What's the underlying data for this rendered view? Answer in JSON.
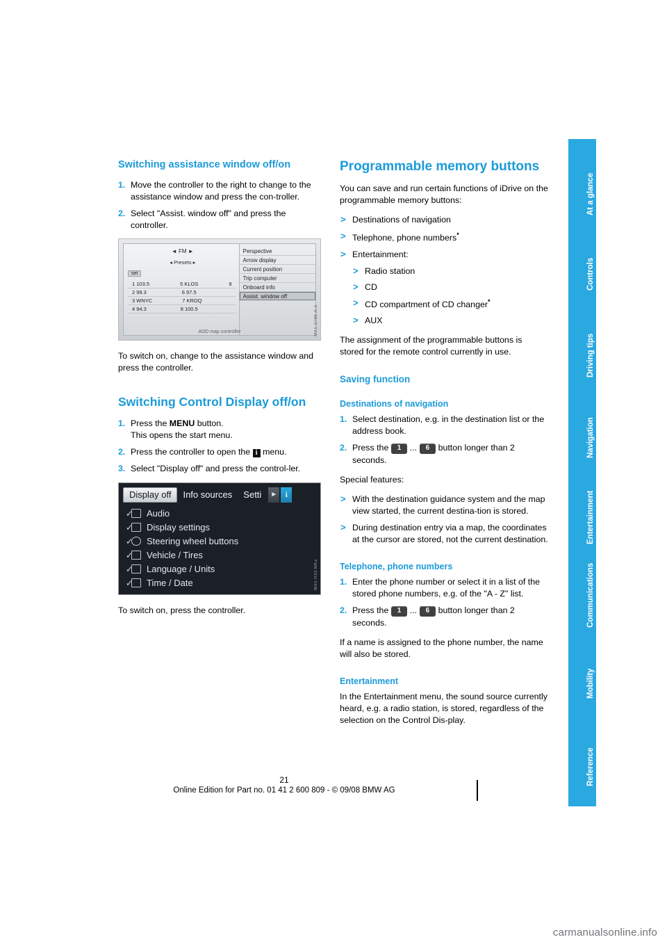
{
  "document": {
    "page_number": "21",
    "footer_line": "Online Edition for Part no. 01 41 2 600 809 - © 09/08 BMW AG",
    "watermark": "carmanualsonline.info"
  },
  "tabs": [
    {
      "label": "At a glance"
    },
    {
      "label": "Controls"
    },
    {
      "label": "Driving tips"
    },
    {
      "label": "Navigation"
    },
    {
      "label": "Entertainment"
    },
    {
      "label": "Communications"
    },
    {
      "label": "Mobility"
    },
    {
      "label": "Reference"
    }
  ],
  "left_column": {
    "heading_1": "Switching assistance window off/on",
    "steps_1": [
      {
        "num": "1.",
        "text": "Move the controller to the right to change to the assistance window and press the con-troller."
      },
      {
        "num": "2.",
        "text": "Select \"Assist. window off\" and press the controller."
      }
    ],
    "figure_1": {
      "code": "MX1-3788-A-A",
      "tabs": "◄   FM   ►",
      "presets": "◂ Presets ▸",
      "set_label": "set",
      "rows": [
        {
          "left": "1 103.5",
          "right": "5 KLOS",
          "num": "9"
        },
        {
          "left": "2 99.3",
          "right": "6 97.5",
          "num": ""
        },
        {
          "left": "3 WNYC",
          "right": "7 KROQ",
          "num": ""
        },
        {
          "left": "4 94.3",
          "right": "8 100.5",
          "num": ""
        }
      ],
      "menu": [
        "Perspective",
        "Arrow display",
        "Current position",
        "Trip computer",
        "Onboard info",
        "Assist. window off"
      ],
      "selected_menu_item": "Assist. window off",
      "bottom_text": "ADD map  controller"
    },
    "paragraph_1": "To switch on, change to the assistance window and press the controller.",
    "heading_2": "Switching Control Display off/on",
    "steps_2": [
      {
        "num": "1.",
        "text_pre": "Press the ",
        "bold": "MENU",
        "text_post": " button.",
        "text_line2": "This opens the start menu."
      },
      {
        "num": "2.",
        "text_pre": "Press the controller to open the ",
        "icon": "i",
        "text_post": " menu."
      },
      {
        "num": "3.",
        "text": "Select \"Display off\" and press the control-ler."
      }
    ],
    "figure_2": {
      "code": "MX0 R33 MKZ",
      "tab_active": "Display off",
      "tab_2": "Info sources",
      "tab_3": "Setti",
      "arrow_icon": "►",
      "info_icon": "i",
      "items": [
        "Audio",
        "Display settings",
        "Steering wheel buttons",
        "Vehicle / Tires",
        "Language / Units",
        "Time / Date"
      ]
    },
    "paragraph_2": "To switch on, press the controller."
  },
  "right_column": {
    "heading_1": "Programmable memory buttons",
    "paragraph_1": "You can save and run certain functions of iDrive on the programmable memory buttons:",
    "bullets_1": [
      {
        "text": "Destinations of navigation",
        "level": 1,
        "sup": ""
      },
      {
        "text": "Telephone, phone numbers",
        "level": 1,
        "sup": "*"
      },
      {
        "text": "Entertainment:",
        "level": 1,
        "sup": ""
      },
      {
        "text": "Radio station",
        "level": 2,
        "sup": ""
      },
      {
        "text": "CD",
        "level": 2,
        "sup": ""
      },
      {
        "text": "CD compartment of CD changer",
        "level": 2,
        "sup": "*"
      },
      {
        "text": "AUX",
        "level": 2,
        "sup": ""
      }
    ],
    "paragraph_2": "The assignment of the programmable buttons is stored for the remote control currently in use.",
    "heading_2": "Saving function",
    "heading_3": "Destinations of navigation",
    "steps_1": [
      {
        "num": "1.",
        "text": "Select destination, e.g. in the destination list or the address book."
      },
      {
        "num": "2.",
        "text_pre": "Press the ",
        "key1": "1",
        "mid": " ... ",
        "key2": "6",
        "text_post": " button longer than 2 seconds."
      }
    ],
    "paragraph_3": "Special features:",
    "bullets_2": [
      {
        "text": "With the destination guidance system and the map view started, the current destina-tion is stored."
      },
      {
        "text": "During destination entry via a map, the coordinates at the cursor are stored, not the current destination."
      }
    ],
    "heading_4": "Telephone, phone numbers",
    "steps_2": [
      {
        "num": "1.",
        "text": "Enter the phone number or select it in a list of the stored phone numbers, e.g. of the \"A - Z\" list."
      },
      {
        "num": "2.",
        "text_pre": "Press the ",
        "key1": "1",
        "mid": " ... ",
        "key2": "6",
        "text_post": " button longer than 2 seconds."
      }
    ],
    "paragraph_4": "If a name is assigned to the phone number, the name will also be stored.",
    "heading_5": "Entertainment",
    "paragraph_5": "In the Entertainment menu, the sound source currently heard, e.g. a radio station, is stored, regardless of the selection on the Control Dis-play."
  }
}
